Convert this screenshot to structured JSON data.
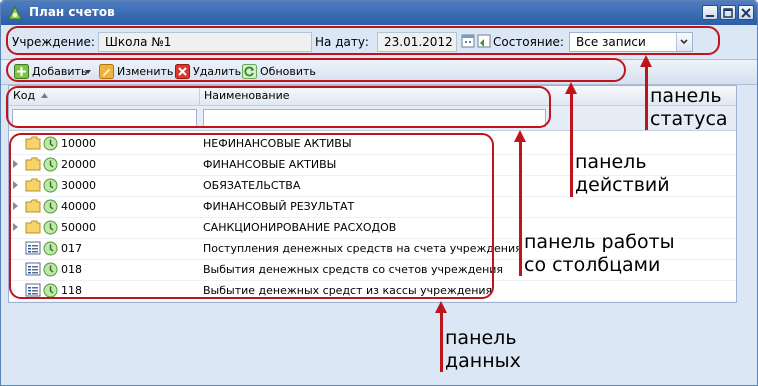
{
  "window": {
    "title": "План счетов"
  },
  "status_panel": {
    "institution_label": "Учреждение:",
    "institution_value": "Школа №1",
    "date_label": "На дату:",
    "date_value": "23.01.2012",
    "state_label": "Состояние:",
    "state_value": "Все записи"
  },
  "toolbar": {
    "add_label": "Добавить",
    "edit_label": "Изменить",
    "delete_label": "Удалить",
    "refresh_label": "Обновить"
  },
  "grid": {
    "columns": [
      {
        "label": "Код",
        "sort": "asc"
      },
      {
        "label": "Наименование"
      }
    ],
    "rows": [
      {
        "code": "10000",
        "name": "НЕФИНАНСОВЫЕ АКТИВЫ",
        "type": "folder",
        "expandable": false
      },
      {
        "code": "20000",
        "name": "ФИНАНСОВЫЕ АКТИВЫ",
        "type": "folder",
        "expandable": true
      },
      {
        "code": "30000",
        "name": "ОБЯЗАТЕЛЬСТВА",
        "type": "folder",
        "expandable": true
      },
      {
        "code": "40000",
        "name": "ФИНАНСОВЫЙ РЕЗУЛЬТАТ",
        "type": "folder",
        "expandable": true
      },
      {
        "code": "50000",
        "name": "САНКЦИОНИРОВАНИЕ РАСХОДОВ",
        "type": "folder",
        "expandable": true
      },
      {
        "code": "017",
        "name": "Поступления денежных средств на счета учреждения",
        "type": "record",
        "expandable": false
      },
      {
        "code": "018",
        "name": "Выбытия денежных средств со счетов учреждения",
        "type": "record",
        "expandable": false
      },
      {
        "code": "118",
        "name": "Выбытие денежных средст из кассы учреждения",
        "type": "record",
        "expandable": false
      }
    ]
  },
  "annotations": {
    "status_panel": [
      "панель",
      "статуса"
    ],
    "actions_panel": [
      "панель",
      "действий"
    ],
    "columns_panel": [
      "панель работы",
      "со столбцами"
    ],
    "data_panel": [
      "панель",
      "данных"
    ]
  },
  "colors": {
    "annotation": "#c0141c",
    "titlebar": "#2a5ea7"
  }
}
